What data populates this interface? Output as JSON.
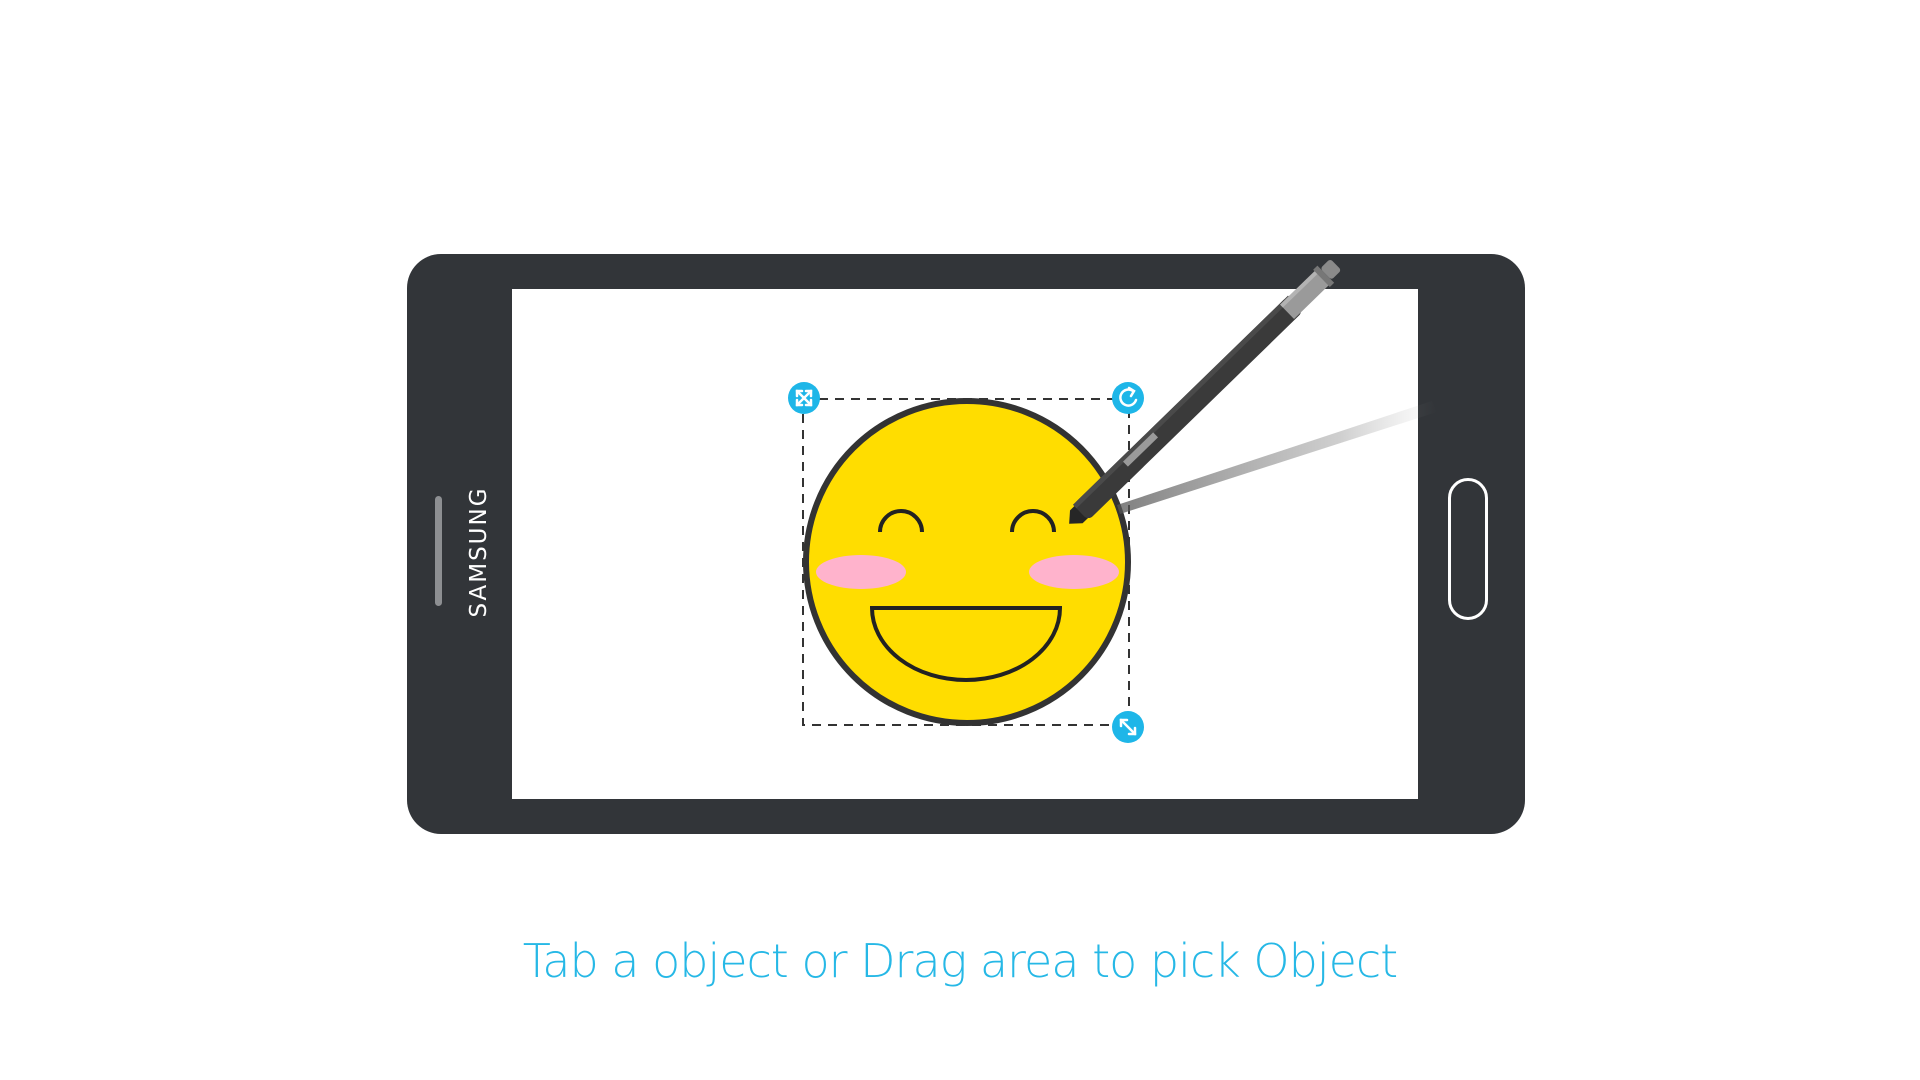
{
  "device": {
    "brand_label": "SAMSUNG",
    "body_color": "#323539",
    "screen_color": "#ffffff"
  },
  "canvas_object": {
    "type": "smiley-face",
    "face_color": "#ffdd00",
    "outline_color": "#333333",
    "blush_color": "#ffb3cc",
    "selected": true
  },
  "selection": {
    "handles": [
      {
        "name": "expand-handle",
        "icon": "expand-arrows-icon"
      },
      {
        "name": "rotate-handle",
        "icon": "rotate-icon"
      },
      {
        "name": "resize-handle",
        "icon": "diagonal-resize-icon"
      }
    ],
    "handle_color": "#1eb6e8"
  },
  "stylus": {
    "body_color": "#3a3a3a",
    "cap_color": "#9a9a9a"
  },
  "caption": {
    "text": "Tab a object or Drag area to pick Object",
    "color": "#26b8e6"
  }
}
